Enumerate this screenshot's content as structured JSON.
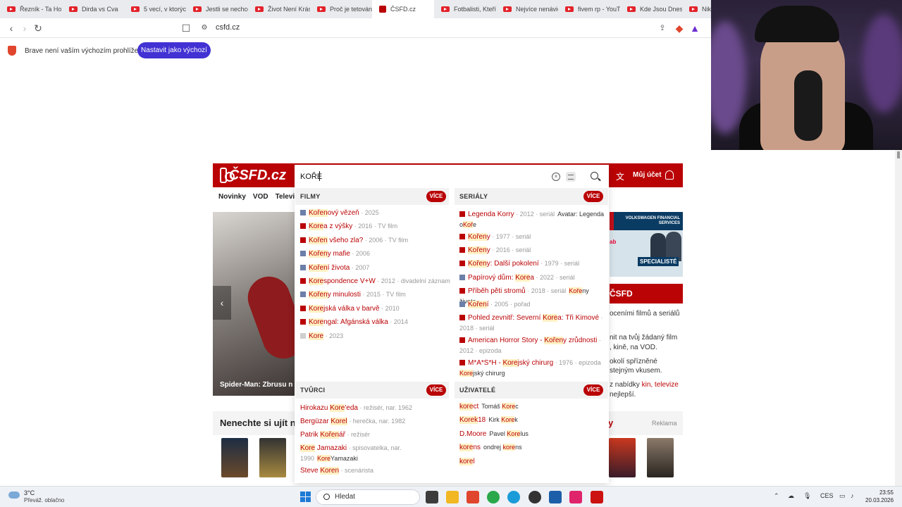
{
  "browser": {
    "tabs": [
      {
        "label": "Řezník - Ta Hol",
        "kind": "yt"
      },
      {
        "label": "Dirda vs Cva",
        "kind": "yt"
      },
      {
        "label": "5 vecí, v ktorýc",
        "kind": "yt"
      },
      {
        "label": "Jestli se nechce",
        "kind": "yt"
      },
      {
        "label": "Život Není Krás",
        "kind": "yt"
      },
      {
        "label": "Proč je tetován",
        "kind": "yt"
      },
      {
        "label": "ČSFD.cz",
        "kind": "csfd"
      },
      {
        "label": "Fotbalisti, Kteří",
        "kind": "yt"
      },
      {
        "label": "Nejvíce nenávic",
        "kind": "yt"
      },
      {
        "label": "fivem rp - YouT",
        "kind": "yt"
      },
      {
        "label": "Kde Jsou Dnes",
        "kind": "yt"
      },
      {
        "label": "Nikto",
        "kind": "yt"
      }
    ],
    "url": "csfd.cz",
    "infobar_text": "Brave není vaším výchozím prohlížečem",
    "set_default_label": "Nastavit jako výchozí"
  },
  "site": {
    "logo": "ČSFD.cz",
    "account_label": "Můj účet",
    "nav": [
      "Novinky",
      "VOD",
      "Televize"
    ],
    "hero_title": "Spider-Man: Zbrusu n",
    "ad": {
      "brand": "VOLKSWAGEN FINANCIAL SERVICES",
      "tagline": "SPECIALISTÉ",
      "side": "ab"
    },
    "box_title": "ČSFD",
    "box_lines": [
      "oceními filmů a seriálů",
      "nit na tvůj žádaný film",
      ", kině, na VOD.",
      "okolí spřízněné",
      "stejným vkusem.",
      "z nabídky",
      "kin, televize",
      "nejlepší."
    ],
    "section_title": "Nenechte si ujít na p",
    "section_side": "y",
    "reklama": "Reklama",
    "section_prefix": "e"
  },
  "search": {
    "value": "KOŘE",
    "more_label": "VÍCE",
    "films": {
      "heading": "FILMY",
      "items": [
        {
          "hl": "Kořen",
          "rest": "ový vězeň",
          "meta": "2025",
          "color": "#6b7fa8"
        },
        {
          "hl": "Kore",
          "rest": "a z výšky",
          "meta": "2016 · TV film",
          "color": "#ba0305"
        },
        {
          "hl": "Kořen",
          "rest": " všeho zla?",
          "meta": "2006 · TV film",
          "color": "#ba0305"
        },
        {
          "hl": "Kořen",
          "rest": "y mafie",
          "meta": "2006",
          "color": "#6b7fa8"
        },
        {
          "hl": "Kořen",
          "rest": "í života",
          "meta": "2007",
          "color": "#6b7fa8"
        },
        {
          "hl": "Kore",
          "rest": "spondence V+W",
          "meta": "2012 · divadelní záznam",
          "color": "#ba0305"
        },
        {
          "hl": "Kořen",
          "rest": "y minulosti",
          "meta": "2015 · TV film",
          "color": "#6b7fa8"
        },
        {
          "hl": "Kore",
          "rest": "jská válka v barvě",
          "meta": "2010",
          "color": "#ba0305"
        },
        {
          "hl": "Kore",
          "rest": "ngal: Afgánská válka",
          "meta": "2014",
          "color": "#ba0305"
        },
        {
          "hl": "Kore",
          "rest": "",
          "meta": "2023",
          "color": "#cfcfcf"
        }
      ]
    },
    "series": {
      "heading": "SERIÁLY",
      "items": [
        {
          "pre": "Legenda Korry",
          "meta": "2012 · seriál",
          "sub_a": "Avatar: Legenda o",
          "sub_hl": "Koř",
          "sub_b": "e",
          "color": "#ba0305"
        },
        {
          "pre": "",
          "hl": "Kořen",
          "rest": "y",
          "meta": "1977 · seriál",
          "color": "#ba0305"
        },
        {
          "pre": "",
          "hl": "Kořen",
          "rest": "y",
          "meta": "2016 · seriál",
          "color": "#ba0305"
        },
        {
          "pre": "",
          "hl": "Kořen",
          "rest": "y: Další pokolení",
          "meta": "1979 · seriál",
          "color": "#ba0305"
        },
        {
          "pre": "Papírový dům: ",
          "hl": "Kore",
          "rest": "a",
          "meta": "2022 · seriál",
          "color": "#6b7fa8"
        },
        {
          "pre": "Příběh pěti stromů",
          "meta": "2018 · seriál",
          "sub_hl": "Koře",
          "sub_b": "ny života",
          "color": "#ba0305"
        },
        {
          "pre": "",
          "hl": "Kořen",
          "rest": "í",
          "meta": "2005 · pořad",
          "color": "#6b7fa8"
        },
        {
          "pre": "Pohled zevnitř: Severní ",
          "hl": "Kore",
          "rest": "a: Tři Kimové",
          "meta": "2018 · seriál",
          "color": "#ba0305"
        },
        {
          "pre": "American Horror Story - ",
          "hl": "Kořen",
          "rest": "y zrůdnosti",
          "meta": "2012 · epizoda",
          "color": "#ba0305"
        },
        {
          "pre": "M*A*S*H - ",
          "hl": "Kore",
          "rest": "jský chirurg",
          "meta": "1976 · epizoda",
          "sub_hl": "Kore",
          "sub_b": "jský chirurg",
          "color": "#ba0305"
        }
      ]
    },
    "creators": {
      "heading": "TVŮRCI",
      "items": [
        {
          "pre": "Hirokazu ",
          "hl": "Kore",
          "rest": "'eda",
          "meta": "režisér, nar. 1962"
        },
        {
          "pre": "Bergüzar ",
          "hl": "Korel",
          "rest": "",
          "meta": "herečka, nar. 1982"
        },
        {
          "pre": "Patrik ",
          "hl": "Kořen",
          "rest": "ář",
          "meta": "režisér"
        },
        {
          "pre": "",
          "hl": "Kore",
          "rest": " Jamazaki",
          "meta": "spisovatelka, nar. 1990",
          "sub_hl": "Kore",
          "sub_b": "Yamazaki"
        },
        {
          "pre": "Steve ",
          "hl": "Koren",
          "rest": "",
          "meta": "scenárista"
        }
      ]
    },
    "users": {
      "heading": "UŽIVATELÉ",
      "items": [
        {
          "hl": "kore",
          "rest": "ct",
          "sub_a": "Tomáš ",
          "sub_hl": "Kore",
          "sub_b": "c"
        },
        {
          "hl": "Korek",
          "rest": "18",
          "sub_a": "Kirk ",
          "sub_hl": "Kore",
          "sub_b": "k"
        },
        {
          "hl": "",
          "rest": "D.Moore",
          "sub_a": "Pavel ",
          "sub_hl": "Kore",
          "sub_b": "lus"
        },
        {
          "hl": "kore",
          "rest": "ns",
          "sub_a": "ondrej ",
          "sub_hl": "kore",
          "sub_b": "ns"
        },
        {
          "hl": "kore",
          "rest": "l",
          "sub_a": "",
          "sub_hl": "",
          "sub_b": ""
        }
      ]
    }
  },
  "taskbar": {
    "temp": "3°C",
    "weather": "Převáž. oblačno",
    "search_label": "Hledat",
    "lang": "CES",
    "time": "23:55",
    "date": "20.03.2026"
  },
  "colors": {
    "brand": "#ba0305",
    "accent": "#4232d3",
    "highlight": "#fff1c4"
  }
}
